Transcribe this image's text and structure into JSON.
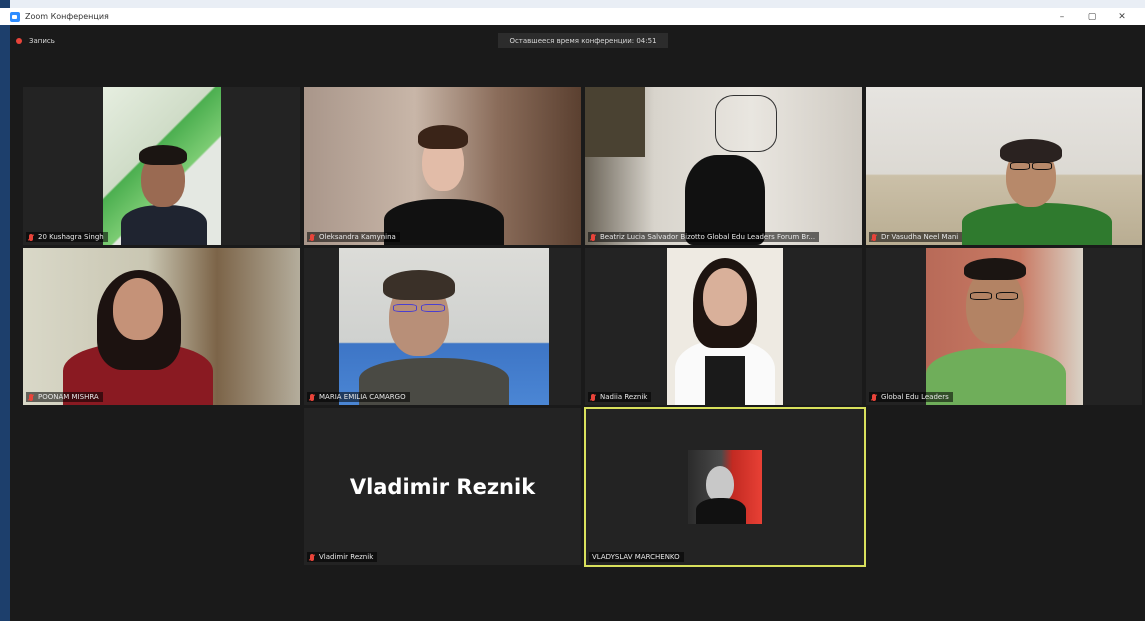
{
  "window": {
    "title": "Zoom Конференция",
    "minimize": "–",
    "maximize": "▢",
    "close": "✕"
  },
  "meeting": {
    "recording_label": "Запись",
    "timer_label": "Оставшееся время конференции: 04:51"
  },
  "participants": [
    {
      "name": "20 Kushagra Singh",
      "muted": true
    },
    {
      "name": "Oleksandra Kamynina",
      "muted": true
    },
    {
      "name": "Beatriz Lucia Salvador Bizotto Global Edu Leaders Forum Br...",
      "muted": true
    },
    {
      "name": "Dr Vasudha Neel Mani",
      "muted": true
    },
    {
      "name": "POONAM MISHRA",
      "muted": true
    },
    {
      "name": "MARIA EMILIA CAMARGO",
      "muted": true
    },
    {
      "name": "Nadiia Reznik",
      "muted": true
    },
    {
      "name": "Global Edu Leaders",
      "muted": true
    },
    {
      "name": "Vladimir Reznik",
      "muted": true,
      "video_off": true,
      "display_name": "Vladimir Reznik"
    },
    {
      "name": "VLADYSLAV MARCHENKO",
      "muted": false,
      "active_speaker": true
    }
  ],
  "colors": {
    "background": "#1a1a1a",
    "tile": "#232323",
    "active_speaker_border": "#d8e05c",
    "mute_icon": "#e8443a"
  }
}
